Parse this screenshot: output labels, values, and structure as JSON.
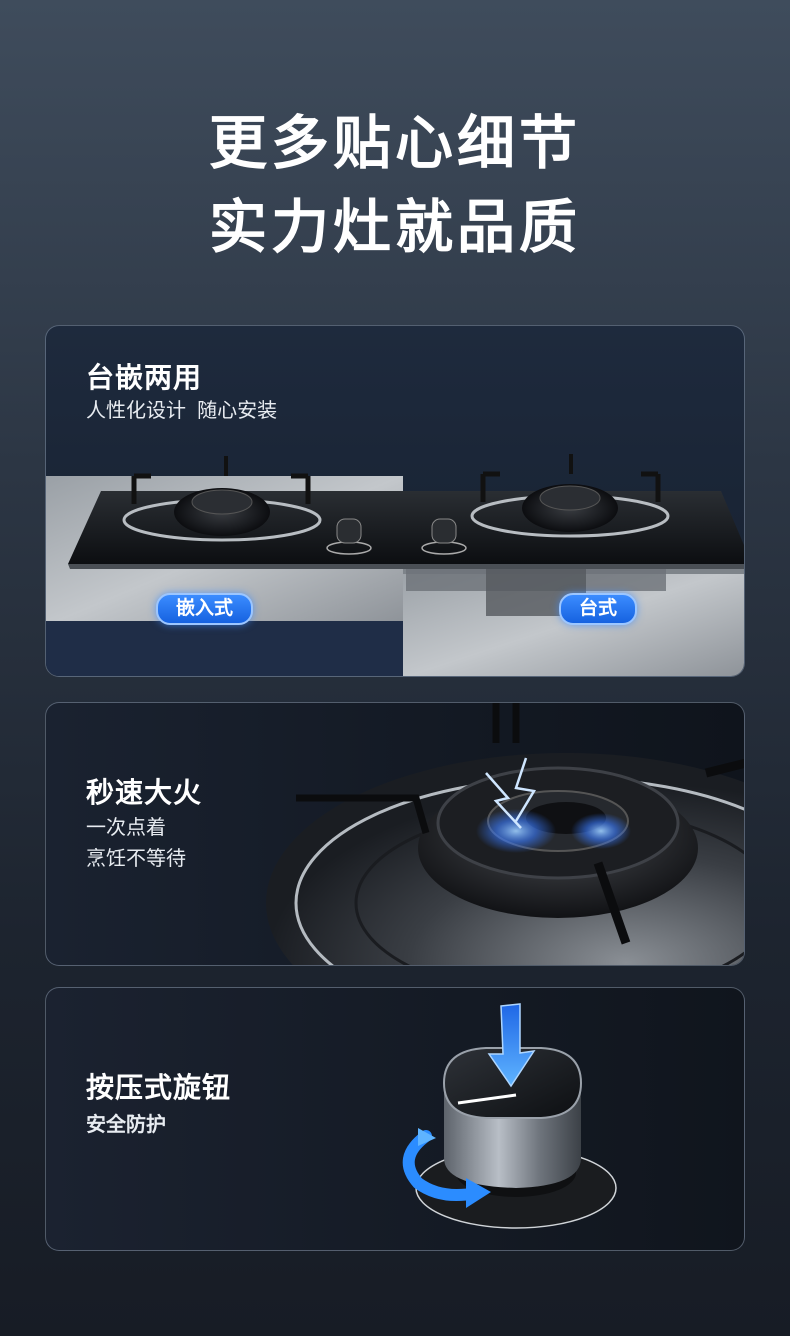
{
  "headline": {
    "line1": "更多贴心细节",
    "line2": "实力灶就品质"
  },
  "features": [
    {
      "title": "台嵌两用",
      "subtitle": "人性化设计  随心安装",
      "badges": [
        "嵌入式",
        "台式"
      ]
    },
    {
      "title": "秒速大火",
      "subtitle_lines": [
        "一次点着",
        "烹饪不等待"
      ]
    },
    {
      "title": "按压式旋钮",
      "subtitle": "安全防护"
    }
  ],
  "colors": {
    "badge_blue": "#1e6ff0",
    "flame_blue": "#3a7bff",
    "arrow_blue": "#2b8cff"
  },
  "icons": [
    "cooktop-image",
    "burner-image",
    "knob-image",
    "press-arrow-icon",
    "rotate-arrow-icon"
  ]
}
